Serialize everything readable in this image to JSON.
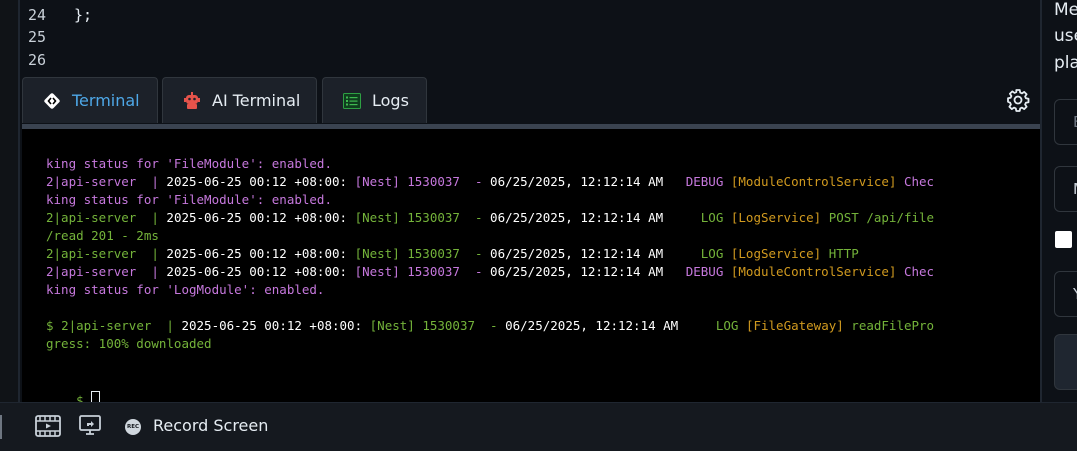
{
  "editor": {
    "lines": [
      {
        "number": "24",
        "code": "};"
      },
      {
        "number": "25",
        "code": ""
      },
      {
        "number": "26",
        "code": ""
      }
    ]
  },
  "tabs": [
    {
      "label": "Terminal",
      "icon": "code-brackets-icon",
      "active": true
    },
    {
      "label": "AI Terminal",
      "icon": "robot-icon",
      "active": false
    },
    {
      "label": "Logs",
      "icon": "logs-icon",
      "active": false
    }
  ],
  "terminal": {
    "lines": [
      {
        "segments": [
          {
            "text": "king status for 'FileModule': enabled.",
            "color": "purple"
          }
        ]
      },
      {
        "segments": [
          {
            "text": "2|api-server  | ",
            "color": "purple"
          },
          {
            "text": "2025-06-25 00:12 +08:00: ",
            "color": "white"
          },
          {
            "text": "[Nest] 1530037  - ",
            "color": "purple"
          },
          {
            "text": "06/25/2025, 12:12:14 AM   ",
            "color": "white"
          },
          {
            "text": "DEBUG ",
            "color": "purple"
          },
          {
            "text": "[ModuleControlService] ",
            "color": "yellow"
          },
          {
            "text": "Chec",
            "color": "purple"
          }
        ]
      },
      {
        "segments": [
          {
            "text": "king status for 'FileModule': enabled.",
            "color": "purple"
          }
        ]
      },
      {
        "segments": [
          {
            "text": "2|api-server  | ",
            "color": "green"
          },
          {
            "text": "2025-06-25 00:12 +08:00: ",
            "color": "white"
          },
          {
            "text": "[Nest] 1530037  - ",
            "color": "green"
          },
          {
            "text": "06/25/2025, 12:12:14 AM     ",
            "color": "white"
          },
          {
            "text": "LOG ",
            "color": "green"
          },
          {
            "text": "[LogService] ",
            "color": "yellow"
          },
          {
            "text": "POST /api/file",
            "color": "green"
          }
        ]
      },
      {
        "segments": [
          {
            "text": "/read 201 - 2ms",
            "color": "green"
          }
        ]
      },
      {
        "segments": [
          {
            "text": "2|api-server  | ",
            "color": "green"
          },
          {
            "text": "2025-06-25 00:12 +08:00: ",
            "color": "white"
          },
          {
            "text": "[Nest] 1530037  - ",
            "color": "green"
          },
          {
            "text": "06/25/2025, 12:12:14 AM     ",
            "color": "white"
          },
          {
            "text": "LOG ",
            "color": "green"
          },
          {
            "text": "[LogService] ",
            "color": "yellow"
          },
          {
            "text": "HTTP",
            "color": "green"
          }
        ]
      },
      {
        "segments": [
          {
            "text": "2|api-server  | ",
            "color": "purple"
          },
          {
            "text": "2025-06-25 00:12 +08:00: ",
            "color": "white"
          },
          {
            "text": "[Nest] 1530037  - ",
            "color": "purple"
          },
          {
            "text": "06/25/2025, 12:12:14 AM   ",
            "color": "white"
          },
          {
            "text": "DEBUG ",
            "color": "purple"
          },
          {
            "text": "[ModuleControlService] ",
            "color": "yellow"
          },
          {
            "text": "Chec",
            "color": "purple"
          }
        ]
      },
      {
        "segments": [
          {
            "text": "king status for 'LogModule': enabled.",
            "color": "purple"
          }
        ]
      },
      {
        "segments": []
      },
      {
        "segments": [
          {
            "text": "$ ",
            "color": "green"
          },
          {
            "text": "2|api-server  | ",
            "color": "green"
          },
          {
            "text": "2025-06-25 00:12 +08:00: ",
            "color": "white"
          },
          {
            "text": "[Nest] 1530037  - ",
            "color": "green"
          },
          {
            "text": "06/25/2025, 12:12:14 AM     ",
            "color": "white"
          },
          {
            "text": "LOG ",
            "color": "green"
          },
          {
            "text": "[FileGateway] ",
            "color": "yellow"
          },
          {
            "text": "readFilePro",
            "color": "green"
          }
        ]
      },
      {
        "segments": [
          {
            "text": "gress: 100% downloaded",
            "color": "green"
          }
        ]
      }
    ],
    "prompt": "$",
    "colors": {
      "purple": "#c678dd",
      "green": "#74b33a",
      "yellow": "#d19a1f",
      "white": "#ffffff"
    }
  },
  "right_panel": {
    "text_lines": [
      "Me",
      "use",
      "pla"
    ],
    "field1_text": "E",
    "field2_text": "M",
    "field3_text": "Y"
  },
  "bottom_toolbar": {
    "record_badge": "REC",
    "record_label": "Record Screen"
  }
}
